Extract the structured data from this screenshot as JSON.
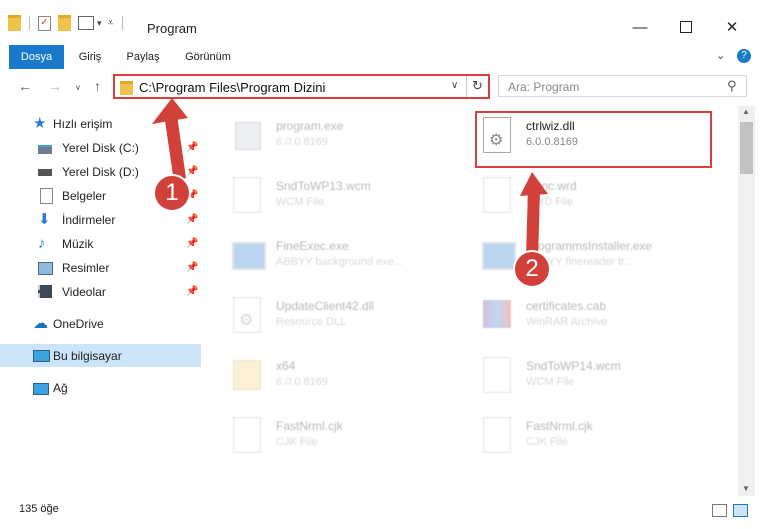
{
  "window": {
    "title": "Program"
  },
  "ribbon": {
    "tabs": [
      "Dosya",
      "Giriş",
      "Paylaş",
      "Görünüm"
    ]
  },
  "address": {
    "path": "C:\\Program Files\\Program Dizini"
  },
  "search": {
    "placeholder": "Ara: Program"
  },
  "sidebar": {
    "quick_access": "Hızlı erişim",
    "items": [
      "Yerel Disk (C:)",
      "Yerel Disk (D:)",
      "Belgeler",
      "İndirmeler",
      "Müzik",
      "Resimler",
      "Videolar"
    ],
    "onedrive": "OneDrive",
    "this_pc": "Bu bilgisayar",
    "network": "Ağ"
  },
  "files": [
    {
      "name": "program.exe",
      "sub": "6.0.0.8169"
    },
    {
      "name": "ctrlwiz.dll",
      "sub": "6.0.0.8169"
    },
    {
      "name": "SndToWP13.wcm",
      "sub": "WCM File"
    },
    {
      "name": "chinc.wrd",
      "sub": "WRD File"
    },
    {
      "name": "FineExec.exe",
      "sub": "ABBYY background exe..."
    },
    {
      "name": "ProgrammsInstaller.exe",
      "sub": "ABBYY finereader tr..."
    },
    {
      "name": "UpdateClient42.dll",
      "sub": "Resource DLL"
    },
    {
      "name": "certificates.cab",
      "sub": "WinRAR Archive"
    },
    {
      "name": "x64",
      "sub": "6.0.0.8169"
    },
    {
      "name": "SndToWP14.wcm",
      "sub": "WCM File"
    },
    {
      "name": "FastNrml.cjk",
      "sub": "CJK File"
    },
    {
      "name": "FastNrml.cjk",
      "sub": "CJK File"
    }
  ],
  "status": {
    "count": "135 öğe"
  },
  "callouts": [
    "1",
    "2"
  ],
  "colors": {
    "accent": "#1979ca",
    "highlight": "#d94040",
    "callout": "#d2403a"
  }
}
